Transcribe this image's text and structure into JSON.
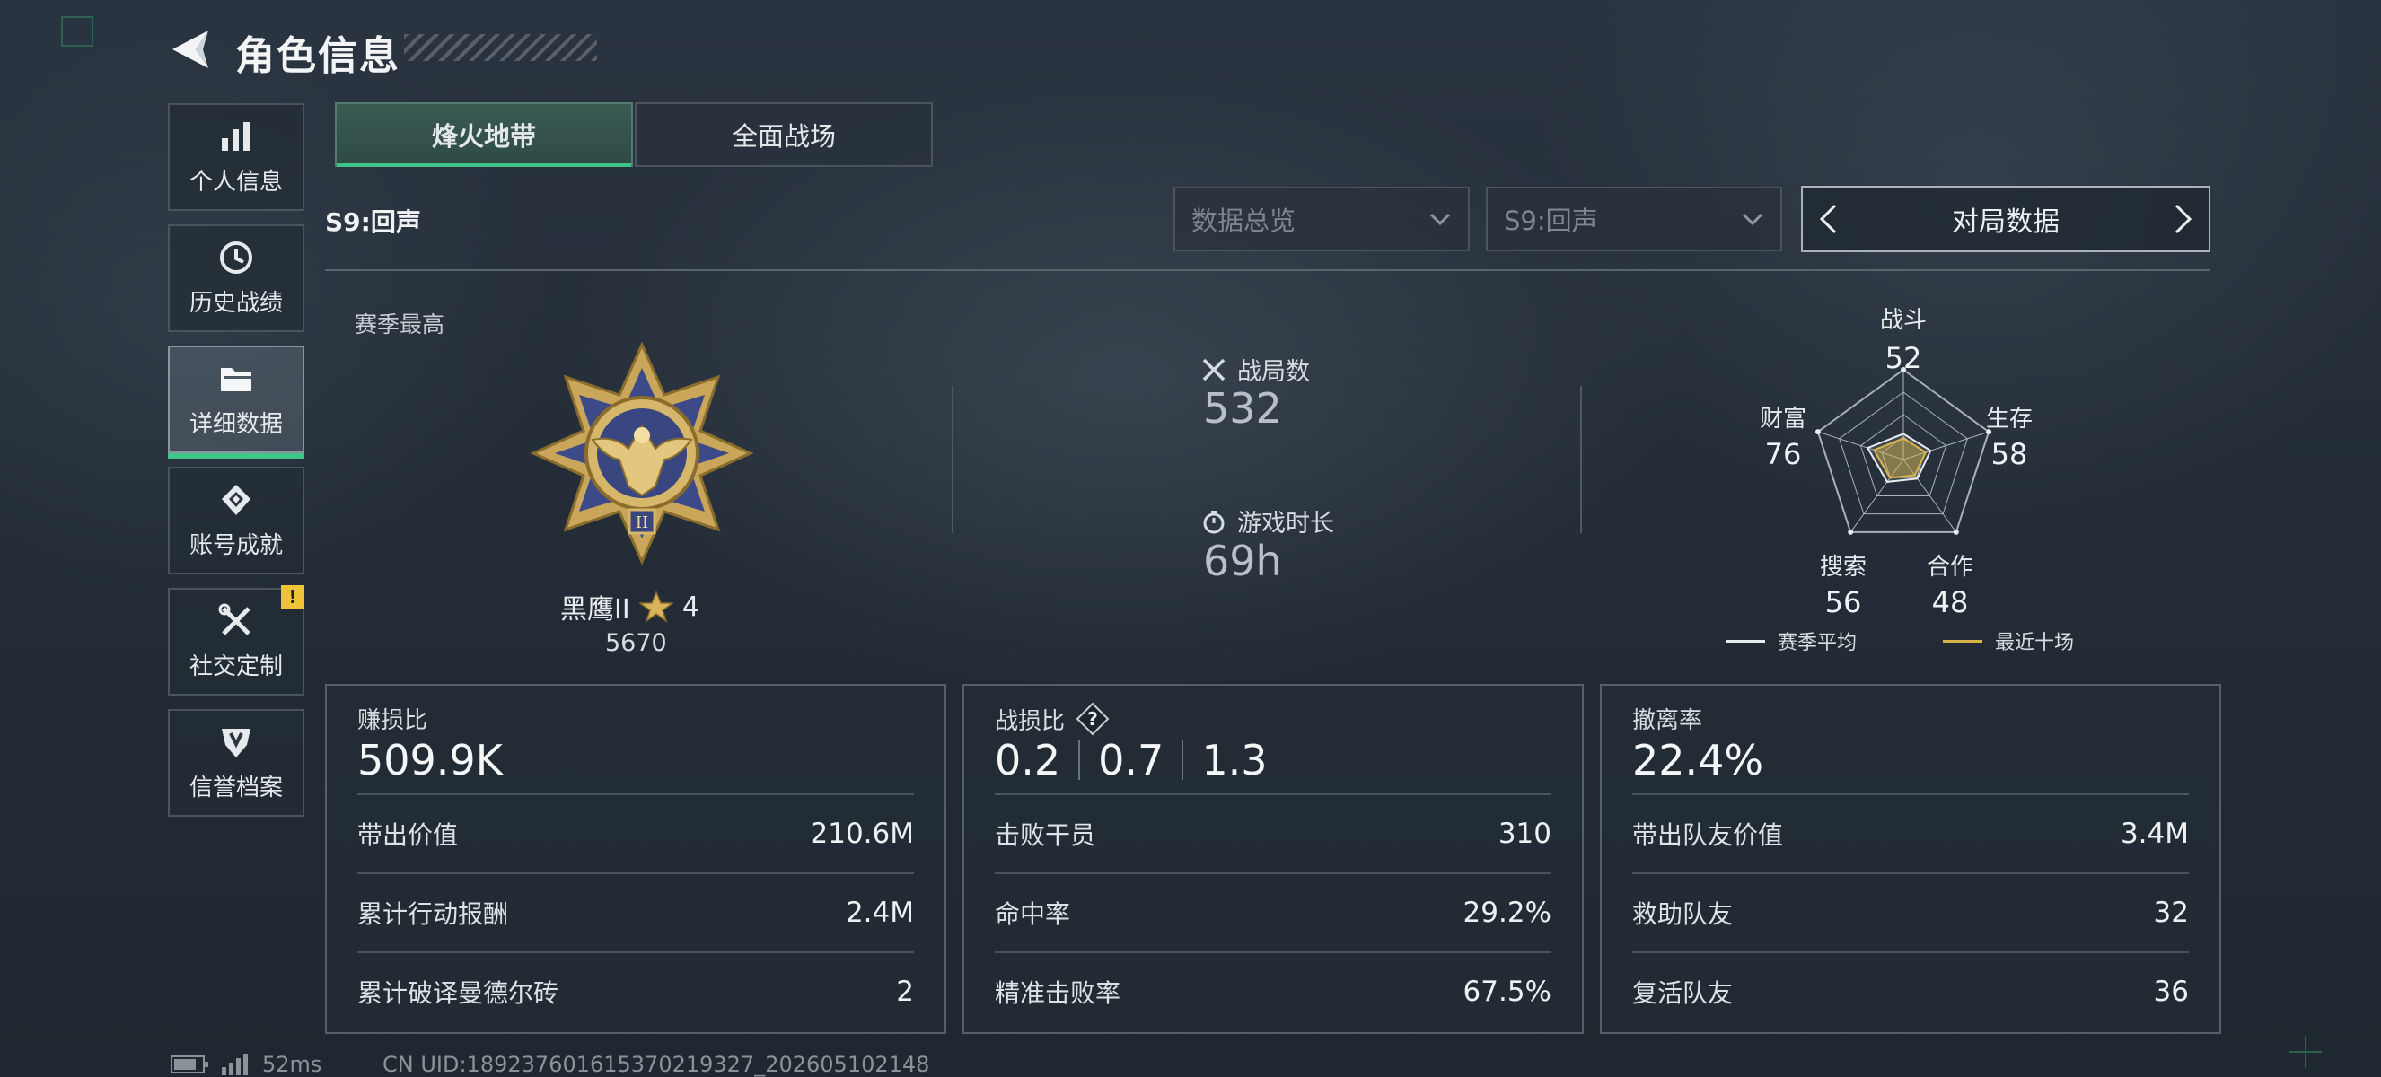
{
  "header": {
    "title": "角色信息"
  },
  "sidebar": {
    "items": [
      {
        "label": "个人信息",
        "icon": "bar-chart-icon",
        "active": false
      },
      {
        "label": "历史战绩",
        "icon": "history-clock-icon",
        "active": false
      },
      {
        "label": "详细数据",
        "icon": "folder-icon",
        "active": true
      },
      {
        "label": "账号成就",
        "icon": "achievement-medal-icon",
        "active": false
      },
      {
        "label": "社交定制",
        "icon": "tools-icon",
        "active": false,
        "badge": "!"
      },
      {
        "label": "信誉档案",
        "icon": "shield-icon",
        "active": false
      }
    ]
  },
  "tabs": [
    {
      "label": "烽火地带",
      "active": true
    },
    {
      "label": "全面战场",
      "active": false
    }
  ],
  "season": {
    "label": "S9:回声"
  },
  "filters": {
    "data_type": "数据总览",
    "season_select": "S9:回声",
    "pager_label": "对局数据"
  },
  "overview": {
    "season_best_label": "赛季最高",
    "rank_name": "黑鹰II",
    "rank_stars": "4",
    "rank_points": "5670",
    "matches_label": "战局数",
    "matches_value": "532",
    "playtime_label": "游戏时长",
    "playtime_value": "69h"
  },
  "radar": {
    "axes": [
      {
        "label": "战斗",
        "value": "52"
      },
      {
        "label": "生存",
        "value": "58"
      },
      {
        "label": "合作",
        "value": "48"
      },
      {
        "label": "搜索",
        "value": "56"
      },
      {
        "label": "财富",
        "value": "76"
      }
    ],
    "legend": {
      "season_avg": "赛季平均",
      "last_ten": "最近十场"
    },
    "colors": {
      "season_avg": "#e8ecee",
      "last_ten": "#d9b44a"
    }
  },
  "cards": {
    "profit": {
      "label": "赚损比",
      "value": "509.9K",
      "rows": [
        {
          "k": "带出价值",
          "v": "210.6M"
        },
        {
          "k": "累计行动报酬",
          "v": "2.4M"
        },
        {
          "k": "累计破译曼德尔砖",
          "v": "2"
        }
      ]
    },
    "kd": {
      "label": "战损比",
      "ratios": [
        "0.2",
        "0.7",
        "1.3"
      ],
      "rows": [
        {
          "k": "击败干员",
          "v": "310"
        },
        {
          "k": "命中率",
          "v": "29.2%"
        },
        {
          "k": "精准击败率",
          "v": "67.5%"
        }
      ]
    },
    "extract": {
      "label": "撤离率",
      "value": "22.4%",
      "rows": [
        {
          "k": "带出队友价值",
          "v": "3.4M"
        },
        {
          "k": "救助队友",
          "v": "32"
        },
        {
          "k": "复活队友",
          "v": "36"
        }
      ]
    }
  },
  "footer": {
    "ping": "52ms",
    "uid": "CN UID:18923760161537021932​7_202605102148"
  },
  "accent": "#3fc58a"
}
